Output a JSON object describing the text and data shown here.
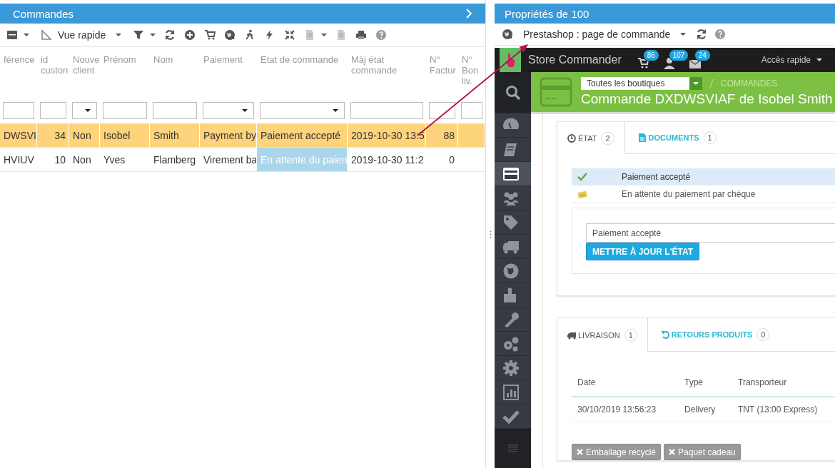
{
  "left_panel": {
    "title": "Commandes",
    "toolbar": {
      "view_label": "Vue rapide"
    },
    "table": {
      "columns": [
        {
          "label": "férence"
        },
        {
          "label": "id custon",
          "kind": "number"
        },
        {
          "label": "Nouve client"
        },
        {
          "label": "Prénom"
        },
        {
          "label": "Nom"
        },
        {
          "label": "Paiement"
        },
        {
          "label": "Etat de commande",
          "kind": "status"
        },
        {
          "label": "Màj état commande"
        },
        {
          "label": "N° Factur",
          "kind": "number"
        },
        {
          "label": "N° Bon liv."
        }
      ],
      "filters": [
        {
          "kind": "text"
        },
        {
          "kind": "text"
        },
        {
          "kind": "select"
        },
        {
          "kind": "text"
        },
        {
          "kind": "text"
        },
        {
          "kind": "select"
        },
        {
          "kind": "select"
        },
        {
          "kind": "text"
        },
        {
          "kind": "text"
        },
        {
          "kind": "text"
        }
      ],
      "rows": [
        {
          "selected": true,
          "cells": [
            "DWSVI",
            "34",
            "Non",
            "Isobel",
            "Smith",
            "Payment by",
            "Paiement accepté",
            "2019-10-30 13:5",
            "88"
          ]
        },
        {
          "selected": false,
          "color": "#a9d6ea",
          "cells": [
            "HVIUV",
            "10",
            "Non",
            "Yves",
            "Flamberg",
            "Virement ba",
            "En attente du paien",
            "2019-10-30 11:2",
            "0"
          ]
        }
      ]
    }
  },
  "right_panel": {
    "title": "Propriétés de 100",
    "toolbar": {
      "view_label": "Prestashop : page de commande"
    },
    "app": {
      "brand": "Store Commander",
      "notifications": [
        {
          "kind": "cart",
          "count": "86"
        },
        {
          "kind": "customer",
          "count": "107"
        },
        {
          "kind": "message",
          "count": "24"
        }
      ],
      "quick_access": "Accès rapide",
      "nav_items": [
        {
          "selected": false
        },
        {
          "selected": false
        },
        {
          "selected": true
        },
        {
          "selected": false
        },
        {
          "selected": false
        },
        {
          "selected": false
        },
        {
          "selected": false
        },
        {
          "selected": false
        },
        {
          "selected": false
        },
        {
          "selected": false
        },
        {
          "selected": false
        },
        {
          "selected": false
        },
        {
          "selected": false
        }
      ],
      "shop_select": "Toutes les boutiques",
      "breadcrumb": "COMMANDES",
      "page_title": "Commande DXDWSVIAF de Isobel Smith",
      "status_tabs": [
        {
          "kind": "clock",
          "label": "ÉTAT",
          "count": "2",
          "selected": true
        },
        {
          "kind": "document",
          "label": "DOCUMENTS",
          "count": "1",
          "selected": false
        }
      ],
      "history": [
        {
          "kind": "accepted",
          "text": "Paiement accepté",
          "selected": true
        },
        {
          "kind": "waiting",
          "text": "En attente du paiement par chèque",
          "selected": false
        }
      ],
      "state_select": "Paiement accepté",
      "update_button": "METTRE À JOUR L'ÉTAT",
      "shipping_tabs": [
        {
          "kind": "truck",
          "label": "LIVRAISON",
          "count": "1",
          "selected": true
        },
        {
          "kind": "return",
          "label": "RETOURS PRODUITS",
          "count": "0",
          "selected": false
        }
      ],
      "shipping_table": {
        "columns": [
          "Date",
          "Type",
          "Transporteur"
        ],
        "rows": [
          [
            "30/10/2019 13:56:23",
            "Delivery",
            "TNT (13:00 Express)"
          ]
        ]
      },
      "option_buttons": [
        "Emballage recyclé",
        "Paquet cadeau"
      ]
    }
  }
}
